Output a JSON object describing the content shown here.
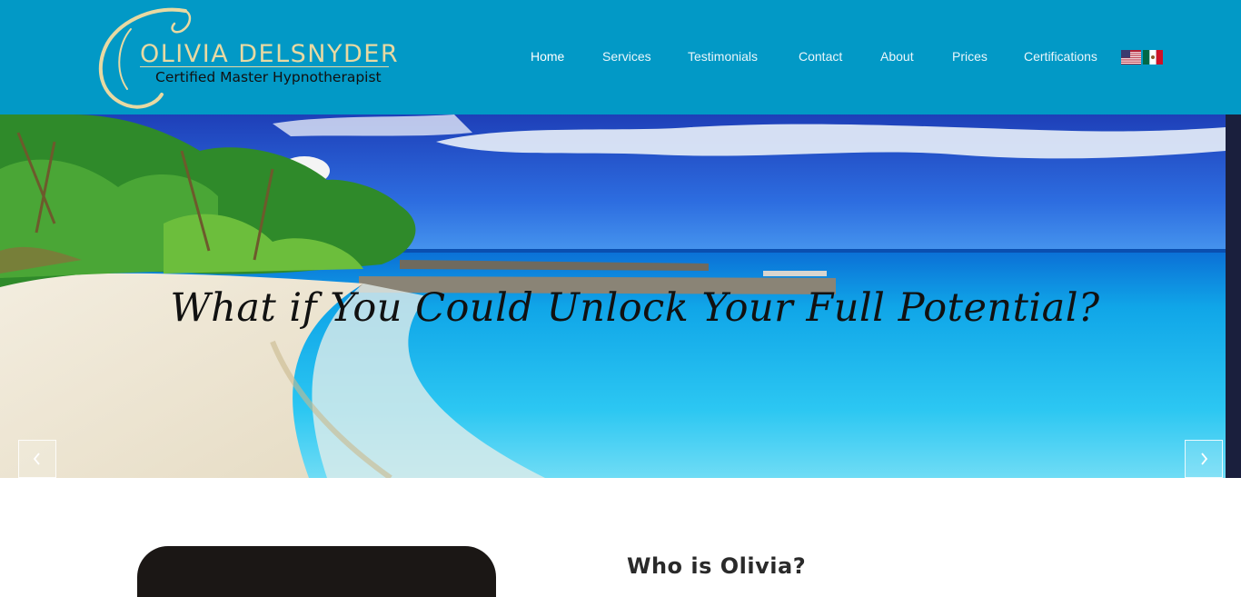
{
  "header": {
    "logo": {
      "name": "OLIVIA DELSNYDER",
      "tagline": "Certified Master Hypnotherapist"
    },
    "nav": [
      {
        "label": "Home",
        "active": true
      },
      {
        "label": "Services",
        "active": false
      },
      {
        "label": "Testimonials",
        "active": false
      },
      {
        "label": "Contact",
        "active": false
      },
      {
        "label": "About",
        "active": false
      },
      {
        "label": "Prices",
        "active": false
      },
      {
        "label": "Certifications",
        "active": false
      }
    ],
    "languages": [
      {
        "icon": "us-flag-icon",
        "lang": "English"
      },
      {
        "icon": "mexico-flag-icon",
        "lang": "Spanish"
      }
    ]
  },
  "hero": {
    "caption": "What if You Could Unlock Your Full Potential?",
    "prev_icon": "chevron-left-icon",
    "next_icon": "chevron-right-icon"
  },
  "about": {
    "title": "Who is Olivia?"
  },
  "colors": {
    "header_bg": "#0299c6",
    "logo_gold": "#e8d9a2",
    "nav_text": "#ffffff"
  }
}
